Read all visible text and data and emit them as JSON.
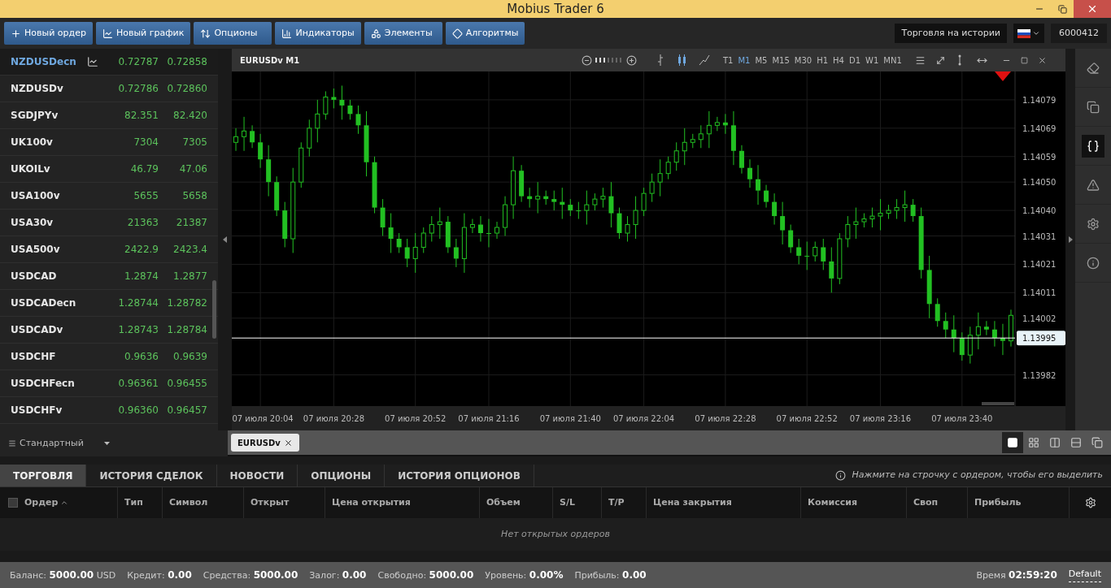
{
  "window": {
    "title": "Mobius Trader 6"
  },
  "toolbar": {
    "buttons": [
      "Новый ордер",
      "Новый график",
      "Опционы",
      "Индикаторы",
      "Элементы",
      "Алгоритмы"
    ],
    "mode_label": "Торговля на истории",
    "account_number": "6000412"
  },
  "watchlist": {
    "rows": [
      {
        "symbol": "NZDUSDecn",
        "bid": "0.72787",
        "ask": "0.72858",
        "selected": true
      },
      {
        "symbol": "NZDUSDv",
        "bid": "0.72786",
        "ask": "0.72860",
        "selected": false
      },
      {
        "symbol": "SGDJPYv",
        "bid": "82.351",
        "ask": "82.420",
        "selected": false
      },
      {
        "symbol": "UK100v",
        "bid": "7304",
        "ask": "7305",
        "selected": false
      },
      {
        "symbol": "UKOILv",
        "bid": "46.79",
        "ask": "47.06",
        "selected": false
      },
      {
        "symbol": "USA100v",
        "bid": "5655",
        "ask": "5658",
        "selected": false
      },
      {
        "symbol": "USA30v",
        "bid": "21363",
        "ask": "21387",
        "selected": false
      },
      {
        "symbol": "USA500v",
        "bid": "2422.9",
        "ask": "2423.4",
        "selected": false
      },
      {
        "symbol": "USDCAD",
        "bid": "1.2874",
        "ask": "1.2877",
        "selected": false
      },
      {
        "symbol": "USDCADecn",
        "bid": "1.28744",
        "ask": "1.28782",
        "selected": false
      },
      {
        "symbol": "USDCADv",
        "bid": "1.28743",
        "ask": "1.28784",
        "selected": false
      },
      {
        "symbol": "USDCHF",
        "bid": "0.9636",
        "ask": "0.9639",
        "selected": false
      },
      {
        "symbol": "USDCHFecn",
        "bid": "0.96361",
        "ask": "0.96455",
        "selected": false
      },
      {
        "symbol": "USDCHFv",
        "bid": "0.96360",
        "ask": "0.96457",
        "selected": false
      }
    ],
    "footer": "Стандартный"
  },
  "chart": {
    "title": "EURUSDv M1",
    "timeframes": [
      {
        "label": "T1",
        "selected": false
      },
      {
        "label": "M1",
        "selected": true
      },
      {
        "label": "M5",
        "selected": false
      },
      {
        "label": "M15",
        "selected": false
      },
      {
        "label": "M30",
        "selected": false
      },
      {
        "label": "H1",
        "selected": false
      },
      {
        "label": "H4",
        "selected": false
      },
      {
        "label": "D1",
        "selected": false
      },
      {
        "label": "W1",
        "selected": false
      },
      {
        "label": "MN1",
        "selected": false
      }
    ],
    "chart_data": {
      "type": "candlestick",
      "color": "#22c022",
      "ylim": [
        1.13971,
        1.14089
      ],
      "grid": true,
      "ref_lines": [
        {
          "axis": "y",
          "value": 1.13995,
          "label": "1.13995",
          "color": "#ffffff"
        }
      ],
      "categories": [
        null,
        null,
        null,
        "07 июля 20:04",
        null,
        null,
        null,
        null,
        null,
        null,
        null,
        null,
        "07 июля 20:28",
        null,
        null,
        null,
        null,
        null,
        null,
        null,
        null,
        null,
        "07 июля 20:52",
        null,
        null,
        null,
        null,
        null,
        null,
        null,
        null,
        "07 июля 21:16",
        null,
        null,
        null,
        null,
        null,
        null,
        null,
        null,
        null,
        "07 июля 21:40",
        null,
        null,
        null,
        null,
        null,
        null,
        null,
        null,
        "07 июля 22:04",
        null,
        null,
        null,
        null,
        null,
        null,
        null,
        null,
        null,
        "07 июля 22:28",
        null,
        null,
        null,
        null,
        null,
        null,
        null,
        null,
        null,
        "07 июля 22:52",
        null,
        null,
        null,
        null,
        null,
        null,
        null,
        null,
        "07 июля 23:16",
        null,
        null,
        null,
        null,
        null,
        null,
        null,
        null,
        null,
        "07 июля 23:40",
        null,
        null,
        null,
        null,
        null,
        null
      ],
      "ohlc": [
        [
          1.14064,
          1.14069,
          1.14061,
          1.14066
        ],
        [
          1.14066,
          1.14073,
          1.14061,
          1.14068
        ],
        [
          1.14068,
          1.1407,
          1.14062,
          1.14064
        ],
        [
          1.14064,
          1.14067,
          1.14055,
          1.14058
        ],
        [
          1.14058,
          1.14063,
          1.14045,
          1.1405
        ],
        [
          1.1405,
          1.14052,
          1.14038,
          1.1404
        ],
        [
          1.1404,
          1.14043,
          1.14027,
          1.1403
        ],
        [
          1.1403,
          1.14055,
          1.14025,
          1.1405
        ],
        [
          1.1405,
          1.14064,
          1.14048,
          1.14062
        ],
        [
          1.14062,
          1.14072,
          1.14059,
          1.14069
        ],
        [
          1.14069,
          1.14079,
          1.14064,
          1.14074
        ],
        [
          1.14074,
          1.14082,
          1.14072,
          1.1408
        ],
        [
          1.1408,
          1.14083,
          1.14076,
          1.14079
        ],
        [
          1.14079,
          1.14084,
          1.14072,
          1.14077
        ],
        [
          1.14077,
          1.14079,
          1.14072,
          1.14074
        ],
        [
          1.14074,
          1.14077,
          1.14067,
          1.1407
        ],
        [
          1.1407,
          1.14075,
          1.14052,
          1.14057
        ],
        [
          1.14057,
          1.14059,
          1.14039,
          1.14041
        ],
        [
          1.14041,
          1.14044,
          1.14031,
          1.14034
        ],
        [
          1.14034,
          1.14039,
          1.14025,
          1.1403
        ],
        [
          1.1403,
          1.14032,
          1.14025,
          1.14027
        ],
        [
          1.14027,
          1.1403,
          1.1402,
          1.14023
        ],
        [
          1.14023,
          1.14032,
          1.14018,
          1.14027
        ],
        [
          1.14027,
          1.14034,
          1.14025,
          1.14032
        ],
        [
          1.14032,
          1.14038,
          1.14029,
          1.14035
        ],
        [
          1.14035,
          1.14041,
          1.1403,
          1.14036
        ],
        [
          1.14036,
          1.14038,
          1.14025,
          1.14027
        ],
        [
          1.14027,
          1.1403,
          1.1402,
          1.14023
        ],
        [
          1.14023,
          1.14039,
          1.14018,
          1.14034
        ],
        [
          1.14034,
          1.14037,
          1.14032,
          1.14035
        ],
        [
          1.14035,
          1.14038,
          1.14029,
          1.14032
        ],
        [
          1.14032,
          1.14037,
          1.14027,
          1.14032
        ],
        [
          1.14032,
          1.14036,
          1.1403,
          1.14034
        ],
        [
          1.14034,
          1.14045,
          1.14031,
          1.14042
        ],
        [
          1.14042,
          1.14059,
          1.14037,
          1.14054
        ],
        [
          1.14054,
          1.14056,
          1.14043,
          1.14045
        ],
        [
          1.14045,
          1.14048,
          1.14041,
          1.14044
        ],
        [
          1.14044,
          1.1405,
          1.14039,
          1.14045
        ],
        [
          1.14045,
          1.14047,
          1.14042,
          1.14044
        ],
        [
          1.14044,
          1.14047,
          1.1404,
          1.14043
        ],
        [
          1.14043,
          1.14048,
          1.14037,
          1.14042
        ],
        [
          1.14042,
          1.14044,
          1.14038,
          1.1404
        ],
        [
          1.1404,
          1.14043,
          1.14037,
          1.1404
        ],
        [
          1.1404,
          1.14047,
          1.14035,
          1.14042
        ],
        [
          1.14042,
          1.14046,
          1.1404,
          1.14044
        ],
        [
          1.14044,
          1.14048,
          1.14041,
          1.14045
        ],
        [
          1.14045,
          1.1405,
          1.14034,
          1.14039
        ],
        [
          1.14039,
          1.14041,
          1.1403,
          1.14032
        ],
        [
          1.14032,
          1.14038,
          1.14029,
          1.14035
        ],
        [
          1.14035,
          1.14045,
          1.1403,
          1.1404
        ],
        [
          1.1404,
          1.14048,
          1.14038,
          1.14046
        ],
        [
          1.14046,
          1.14053,
          1.14043,
          1.1405
        ],
        [
          1.1405,
          1.14058,
          1.14045,
          1.14053
        ],
        [
          1.14053,
          1.14059,
          1.14051,
          1.14057
        ],
        [
          1.14057,
          1.14064,
          1.14054,
          1.14061
        ],
        [
          1.14061,
          1.14069,
          1.14056,
          1.14064
        ],
        [
          1.14064,
          1.14067,
          1.14062,
          1.14065
        ],
        [
          1.14065,
          1.1407,
          1.14062,
          1.14067
        ],
        [
          1.14067,
          1.14075,
          1.14062,
          1.1407
        ],
        [
          1.1407,
          1.14073,
          1.14068,
          1.14071
        ],
        [
          1.14071,
          1.14074,
          1.14067,
          1.1407
        ],
        [
          1.1407,
          1.14075,
          1.14056,
          1.14061
        ],
        [
          1.14061,
          1.14063,
          1.14053,
          1.14055
        ],
        [
          1.14055,
          1.14058,
          1.14048,
          1.14051
        ],
        [
          1.14051,
          1.14056,
          1.14042,
          1.14047
        ],
        [
          1.14047,
          1.14049,
          1.14041,
          1.14043
        ],
        [
          1.14043,
          1.14046,
          1.14035,
          1.14038
        ],
        [
          1.14038,
          1.14043,
          1.14028,
          1.14033
        ],
        [
          1.14033,
          1.14035,
          1.14025,
          1.14027
        ],
        [
          1.14027,
          1.1403,
          1.14021,
          1.14024
        ],
        [
          1.14024,
          1.14029,
          1.14019,
          1.14024
        ],
        [
          1.14024,
          1.14029,
          1.14022,
          1.14027
        ],
        [
          1.14027,
          1.1403,
          1.14019,
          1.14022
        ],
        [
          1.14022,
          1.14027,
          1.14011,
          1.14016
        ],
        [
          1.14016,
          1.14032,
          1.14014,
          1.1403
        ],
        [
          1.1403,
          1.14038,
          1.14027,
          1.14035
        ],
        [
          1.14035,
          1.14041,
          1.1403,
          1.14036
        ],
        [
          1.14036,
          1.14039,
          1.14034,
          1.14037
        ],
        [
          1.14037,
          1.14041,
          1.14034,
          1.14038
        ],
        [
          1.14038,
          1.14044,
          1.14033,
          1.14039
        ],
        [
          1.14039,
          1.14042,
          1.14037,
          1.1404
        ],
        [
          1.1404,
          1.14044,
          1.14037,
          1.14041
        ],
        [
          1.14041,
          1.14047,
          1.14036,
          1.14042
        ],
        [
          1.14042,
          1.14044,
          1.14036,
          1.14038
        ],
        [
          1.14038,
          1.14041,
          1.14016,
          1.14019
        ],
        [
          1.14019,
          1.14024,
          1.14002,
          1.14007
        ],
        [
          1.14007,
          1.14009,
          1.13999,
          1.14001
        ],
        [
          1.14001,
          1.14004,
          1.13995,
          1.13998
        ],
        [
          1.13998,
          1.14003,
          1.1399,
          1.13995
        ],
        [
          1.13995,
          1.13997,
          1.13987,
          1.13989
        ],
        [
          1.13989,
          1.13999,
          1.13986,
          1.13996
        ],
        [
          1.13996,
          1.14004,
          1.13991,
          1.13999
        ],
        [
          1.13999,
          1.14001,
          1.13996,
          1.13998
        ],
        [
          1.13998,
          1.14001,
          1.13992,
          1.13995
        ],
        [
          1.13995,
          1.14,
          1.13989,
          1.13994
        ],
        [
          1.13994,
          1.14005,
          1.13992,
          1.14003
        ]
      ],
      "yticks": [
        {
          "value": 1.14079,
          "label": "1.14079"
        },
        {
          "value": 1.14069,
          "label": "1.14069"
        },
        {
          "value": 1.14059,
          "label": "1.14059"
        },
        {
          "value": 1.1405,
          "label": "1.14050"
        },
        {
          "value": 1.1404,
          "label": "1.14040"
        },
        {
          "value": 1.14031,
          "label": "1.14031"
        },
        {
          "value": 1.14021,
          "label": "1.14021"
        },
        {
          "value": 1.14011,
          "label": "1.14011"
        },
        {
          "value": 1.14002,
          "label": "1.14002"
        },
        {
          "value": 1.13982,
          "label": "1.13982"
        }
      ]
    }
  },
  "chart_tabs": [
    {
      "label": "EURUSDv",
      "selected": true
    }
  ],
  "layouts": [
    {
      "selected": true
    },
    {
      "selected": false
    },
    {
      "selected": false
    },
    {
      "selected": false
    },
    {
      "selected": false
    }
  ],
  "side_tools": [
    {
      "selected": false
    },
    {
      "selected": false
    },
    {
      "selected": true
    },
    {
      "selected": false
    },
    {
      "selected": false
    },
    {
      "selected": false
    }
  ],
  "bottom_tabs": [
    {
      "label": "ТОРГОВЛЯ",
      "selected": true
    },
    {
      "label": "ИСТОРИЯ СДЕЛОК",
      "selected": false
    },
    {
      "label": "НОВОСТИ",
      "selected": false
    },
    {
      "label": "ОПЦИОНЫ",
      "selected": false
    },
    {
      "label": "ИСТОРИЯ ОПЦИОНОВ",
      "selected": false
    }
  ],
  "hint": "Нажмите на строчку с ордером, чтобы его выделить",
  "select_all": {
    "checked": false
  },
  "columns": [
    "Ордер",
    "Тип",
    "Символ",
    "Открыт",
    "Цена открытия",
    "Объем",
    "S/L",
    "T/P",
    "Цена закрытия",
    "Комиссия",
    "Своп",
    "Прибыль"
  ],
  "empty_message": "Нет открытых ордеров",
  "status": {
    "items": [
      {
        "label": "Баланс:",
        "value": "5000.00",
        "unit": "USD"
      },
      {
        "label": "Кредит:",
        "value": "0.00"
      },
      {
        "label": "Средства:",
        "value": "5000.00"
      },
      {
        "label": "Залог:",
        "value": "0.00"
      },
      {
        "label": "Свободно:",
        "value": "5000.00"
      },
      {
        "label": "Уровень:",
        "value": "0.00%"
      },
      {
        "label": "Прибыль:",
        "value": "0.00"
      }
    ],
    "time_label": "Время",
    "time": "02:59:20",
    "profile": "Default"
  }
}
